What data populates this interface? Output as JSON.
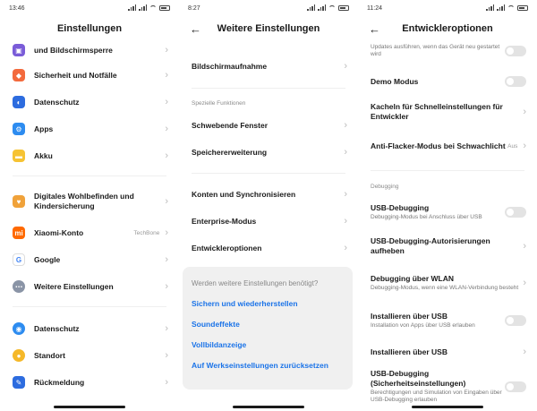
{
  "panel1": {
    "time": "13:46",
    "title": "Einstellungen",
    "items": [
      {
        "label": "und Bildschirmsperre",
        "color": "#7a5cd8"
      },
      {
        "label": "Sicherheit und Notfälle",
        "color": "#f36a3d"
      },
      {
        "label": "Datenschutz",
        "color": "#2d6cdf"
      },
      {
        "label": "Apps",
        "color": "#2d8cf0"
      },
      {
        "label": "Akku",
        "color": "#f6c333"
      },
      {
        "label": "Digitales Wohlbefinden und Kindersicherung",
        "color": "#f0a23a"
      },
      {
        "label": "Xiaomi-Konto",
        "value": "TechBone",
        "color": "#ff6900",
        "glyph": "mi"
      },
      {
        "label": "Google",
        "color": "#4285f4",
        "glyph": "G"
      },
      {
        "label": "Weitere Einstellungen",
        "color": "#8a94a6"
      },
      {
        "label": "Datenschutz",
        "color": "#2d8cf0"
      },
      {
        "label": "Standort",
        "color": "#f5b829"
      },
      {
        "label": "Rückmeldung",
        "color": "#2d6cdf"
      }
    ]
  },
  "panel2": {
    "time": "8:27",
    "title": "Weitere Einstellungen",
    "items": [
      {
        "label": "Bildschirmaufnahme"
      },
      {
        "label": "Schwebende Fenster"
      },
      {
        "label": "Speichererweiterung"
      },
      {
        "label": "Konten und Synchronisieren"
      },
      {
        "label": "Enterprise-Modus"
      },
      {
        "label": "Entwickleroptionen"
      }
    ],
    "section_label": "Spezielle Funktionen",
    "card": {
      "question": "Werden weitere Einstellungen benötigt?",
      "links": [
        "Sichern und wiederherstellen",
        "Soundeffekte",
        "Vollbildanzeige",
        "Auf Werkseinstellungen zurücksetzen"
      ]
    }
  },
  "panel3": {
    "time": "11:24",
    "title": "Entwickleroptionen",
    "top_sub": "Updates ausführen, wenn das Gerät neu gestartet wird",
    "items": [
      {
        "label": "Demo Modus"
      },
      {
        "label": "Kacheln für Schnelleinstellungen für Entwickler"
      },
      {
        "label": "Anti-Flacker-Modus bei Schwachlicht",
        "value": "Aus"
      },
      {
        "label": "USB-Debugging",
        "sub": "Debugging-Modus bei Anschluss über USB"
      },
      {
        "label": "USB-Debugging-Autorisierungen aufheben"
      },
      {
        "label": "Debugging über WLAN",
        "sub": "Debugging-Modus, wenn eine WLAN-Verbindung besteht"
      },
      {
        "label": "Installieren über USB",
        "sub": "Installation von Apps über USB erlauben"
      },
      {
        "label": "Installieren über USB"
      },
      {
        "label": "USB-Debugging (Sicherheitseinstellungen)",
        "sub": "Berechtigungen und Simulation von Eingaben über USB-Debugging erlauben"
      }
    ],
    "section_label": "Debugging"
  }
}
